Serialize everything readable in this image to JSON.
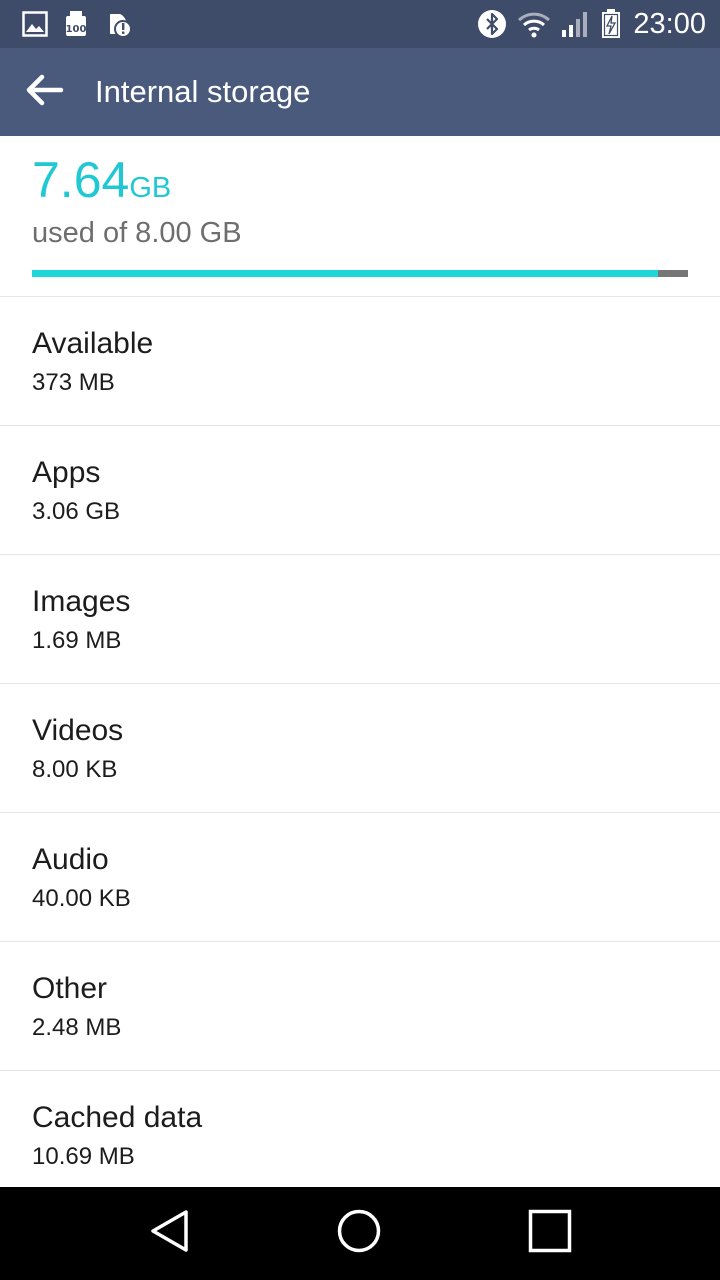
{
  "status_bar": {
    "time": "23:00",
    "left_icons": [
      "image-notification-icon",
      "sd-card-icon",
      "alert-notification-icon"
    ],
    "right_icons": [
      "bluetooth-icon",
      "wifi-icon",
      "signal-icon",
      "battery-charging-icon"
    ]
  },
  "app_bar": {
    "title": "Internal storage",
    "back_icon": "arrow-left-icon"
  },
  "summary": {
    "used_value": "7.64",
    "used_unit": "GB",
    "used_of_text": "used of 8.00 GB",
    "used_fraction": 0.955,
    "accent_color": "#1fd6d9"
  },
  "items": [
    {
      "label": "Available",
      "value": "373 MB"
    },
    {
      "label": "Apps",
      "value": "3.06 GB"
    },
    {
      "label": "Images",
      "value": "1.69 MB"
    },
    {
      "label": "Videos",
      "value": "8.00 KB"
    },
    {
      "label": "Audio",
      "value": "40.00 KB"
    },
    {
      "label": "Other",
      "value": "2.48 MB"
    },
    {
      "label": "Cached data",
      "value": "10.69 MB"
    }
  ],
  "nav_bar": {
    "icons": [
      "back-triangle-icon",
      "home-circle-icon",
      "recents-square-icon"
    ]
  }
}
